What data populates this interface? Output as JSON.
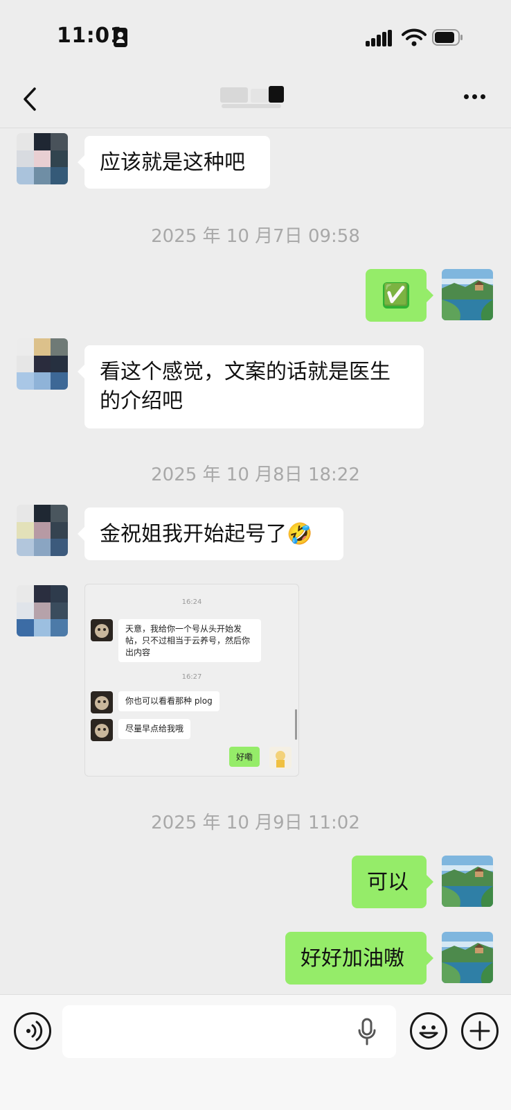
{
  "status_bar": {
    "time": "11:01"
  },
  "nav": {
    "title": ""
  },
  "messages": {
    "m1": "应该就是这种吧",
    "ts1": "2025 年 10 月7日 09:58",
    "m2": "✅",
    "m3": "看这个感觉，文案的话就是医生的介绍吧",
    "ts2": "2025 年 10 月8日 18:22",
    "m4": "金祝姐我开始起号了🤣",
    "ts3": "2025 年 10 月9日 11:02",
    "m5": "可以",
    "m6": "好好加油嗷"
  },
  "shared_screenshot": {
    "ts_a": "16:24",
    "msg_a": "天意，我给你一个号从头开始发帖，只不过相当于云养号，然后你出内容",
    "ts_b": "16:27",
    "msg_b": "你也可以看看那种 plog",
    "msg_c": "尽量早点给我哦",
    "reply": "好嘞"
  },
  "input": {
    "placeholder": ""
  },
  "colors": {
    "sent_bubble": "#95ec69",
    "received_bubble": "#ffffff",
    "background": "#ededed"
  },
  "icons": [
    "voice-mode-icon",
    "microphone-icon",
    "emoji-icon",
    "plus-icon",
    "back-chevron-icon",
    "more-icon"
  ]
}
